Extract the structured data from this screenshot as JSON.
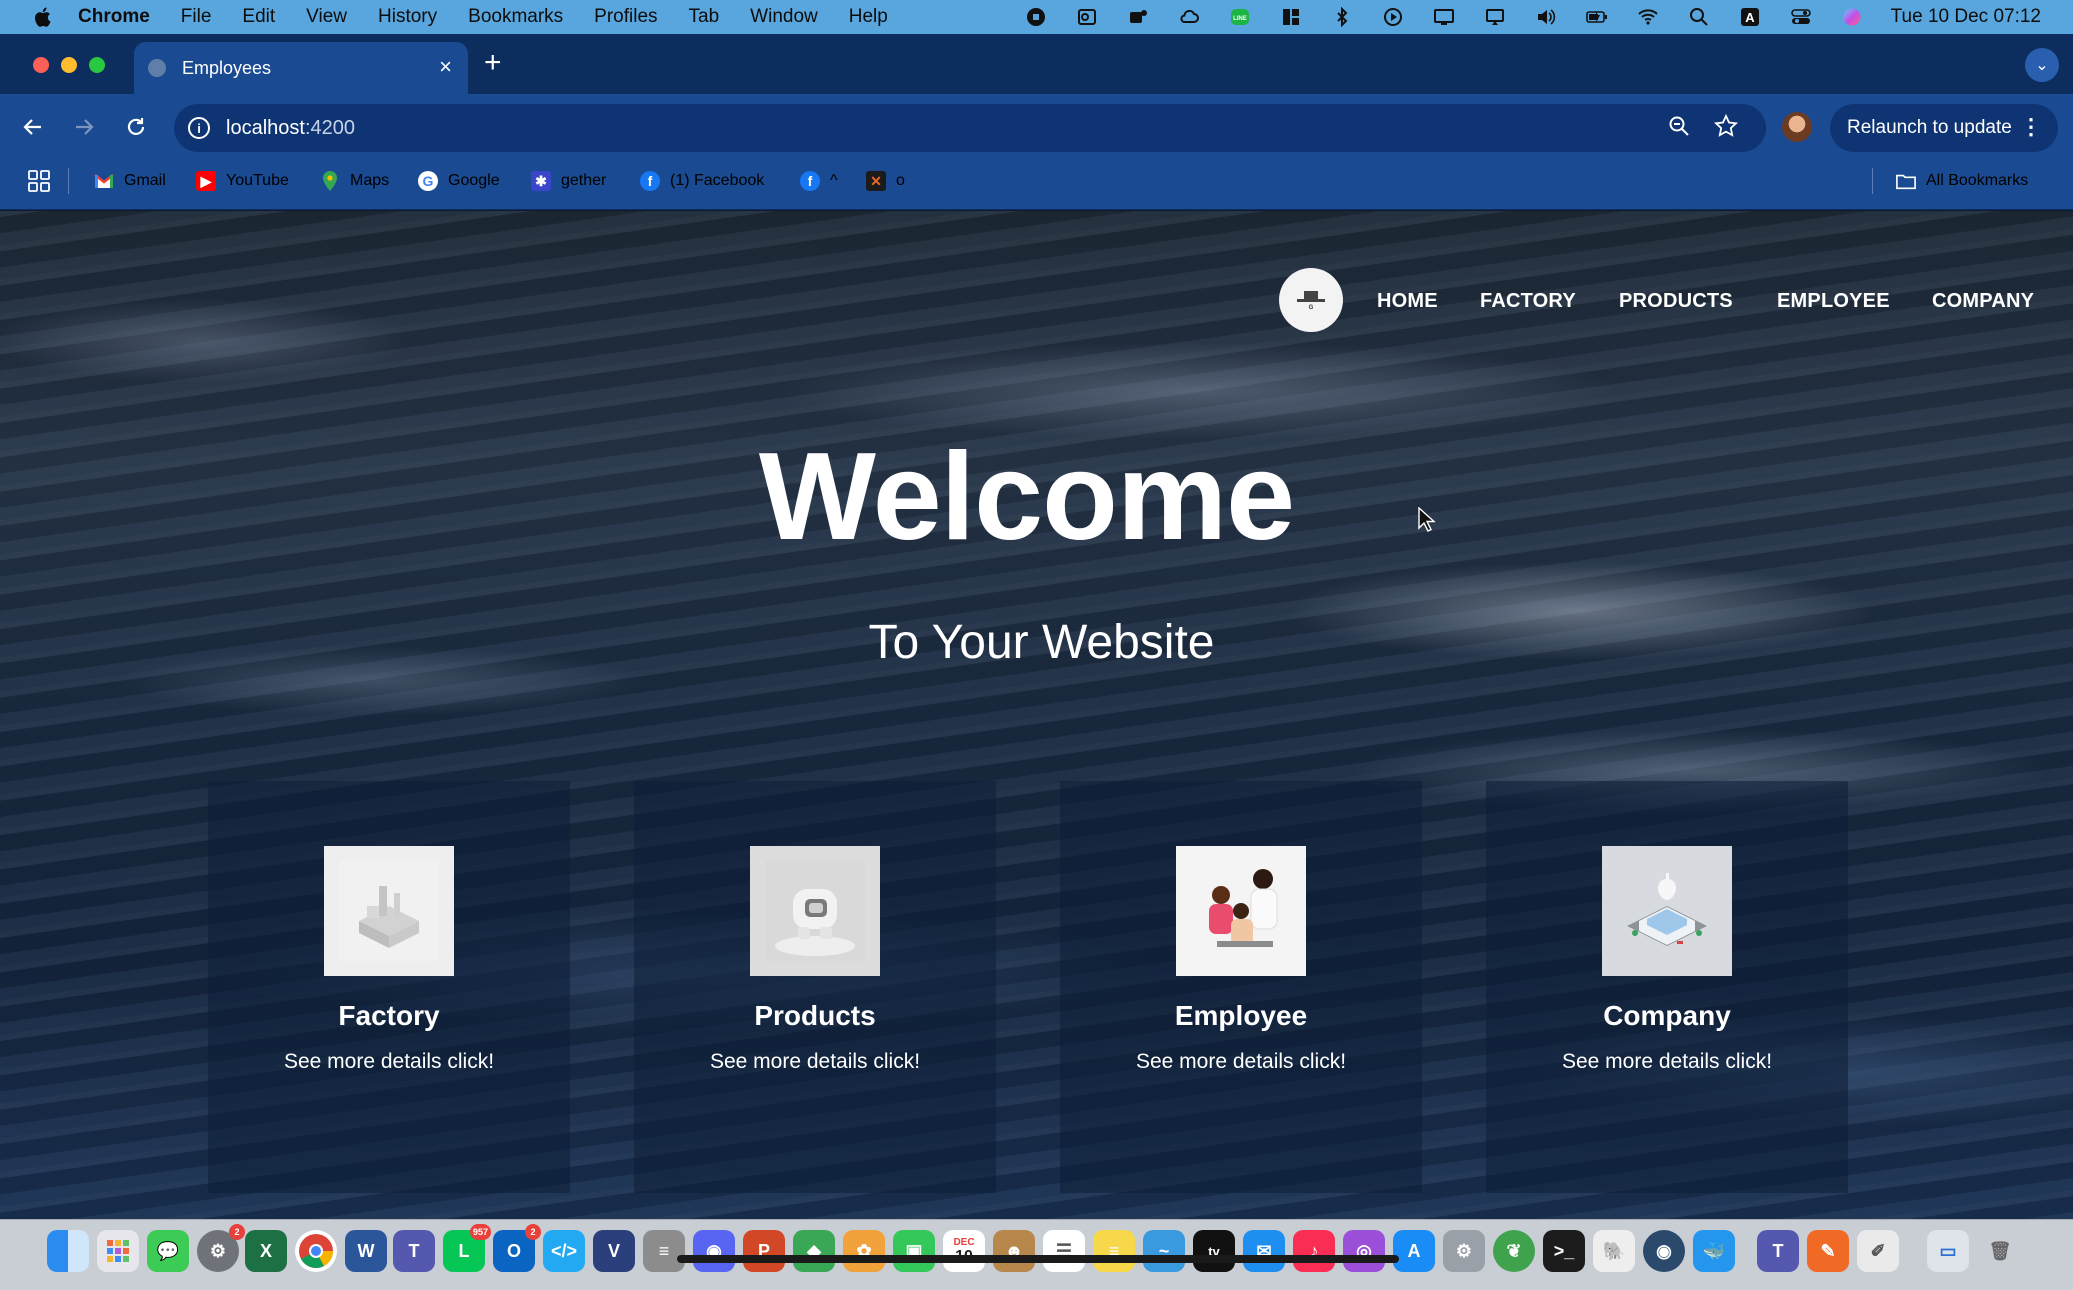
{
  "menubar": {
    "app": "Chrome",
    "items": [
      "File",
      "Edit",
      "View",
      "History",
      "Bookmarks",
      "Profiles",
      "Tab",
      "Window",
      "Help"
    ],
    "clock": "Tue 10 Dec  07:12",
    "input_indicator": "A"
  },
  "browser": {
    "tab_title": "Employees",
    "url_host": "localhost",
    "url_port": ":4200",
    "relaunch_label": "Relaunch to update",
    "bookmarks": [
      {
        "label": "Gmail",
        "icon": "gmail-icon",
        "color": "#ea4335"
      },
      {
        "label": "YouTube",
        "icon": "youtube-icon",
        "color": "#ff0000"
      },
      {
        "label": "Maps",
        "icon": "maps-icon",
        "color": "#34a853"
      },
      {
        "label": "Google",
        "icon": "google-icon",
        "color": "#4285f4"
      },
      {
        "label": "gether",
        "icon": "gether-icon",
        "color": "#3b45c9"
      },
      {
        "label": "(1) Facebook",
        "icon": "facebook-icon",
        "color": "#1877f2"
      },
      {
        "label": "^",
        "icon": "facebook-icon",
        "color": "#1877f2"
      },
      {
        "label": "o",
        "icon": "x-orange-icon",
        "color": "#e8672a"
      }
    ],
    "all_bookmarks_label": "All Bookmarks"
  },
  "site": {
    "nav": [
      "HOME",
      "FACTORY",
      "PRODUCTS",
      "EMPLOYEE",
      "COMPANY"
    ],
    "hero_title": "Welcome",
    "hero_subtitle": "To Your Website",
    "cards": [
      {
        "title": "Factory",
        "link": "See more details click!",
        "image": "factory-image"
      },
      {
        "title": "Products",
        "link": "See more details click!",
        "image": "robot-product-image"
      },
      {
        "title": "Employee",
        "link": "See more details click!",
        "image": "people-team-image"
      },
      {
        "title": "Company",
        "link": "See more details click!",
        "image": "apple-store-building-image"
      }
    ]
  },
  "dock": {
    "badges": {
      "messages": "2",
      "line": "957",
      "outlook": "2"
    },
    "calendar_month": "DEC",
    "calendar_day": "10",
    "tv_label": "tv"
  }
}
